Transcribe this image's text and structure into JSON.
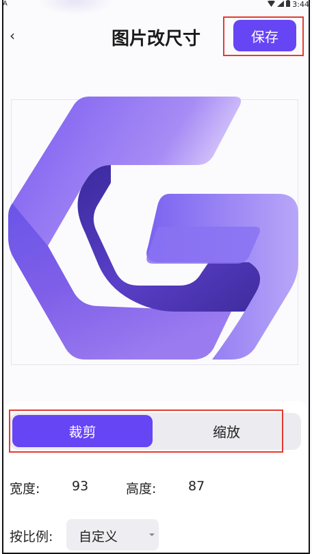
{
  "status": {
    "left_glyph": "A",
    "time": "3:44",
    "icons": [
      "wifi-icon",
      "signal-icon",
      "battery-icon"
    ]
  },
  "header": {
    "back_label": "‹",
    "title": "图片改尺寸",
    "save_label": "保存"
  },
  "colors": {
    "accent": "#6645f5",
    "highlight_border": "#e53a2e",
    "segment_bg": "#ececf0",
    "select_bg": "#eeeef2"
  },
  "image": {
    "icon": "g-logo-image"
  },
  "mode_tabs": [
    {
      "label": "裁剪",
      "selected": true
    },
    {
      "label": "缩放",
      "selected": false
    }
  ],
  "size": {
    "width_label": "宽度:",
    "width_value": "93",
    "height_label": "高度:",
    "height_value": "87"
  },
  "ratio": {
    "label": "按比例:",
    "selected": "自定义"
  }
}
